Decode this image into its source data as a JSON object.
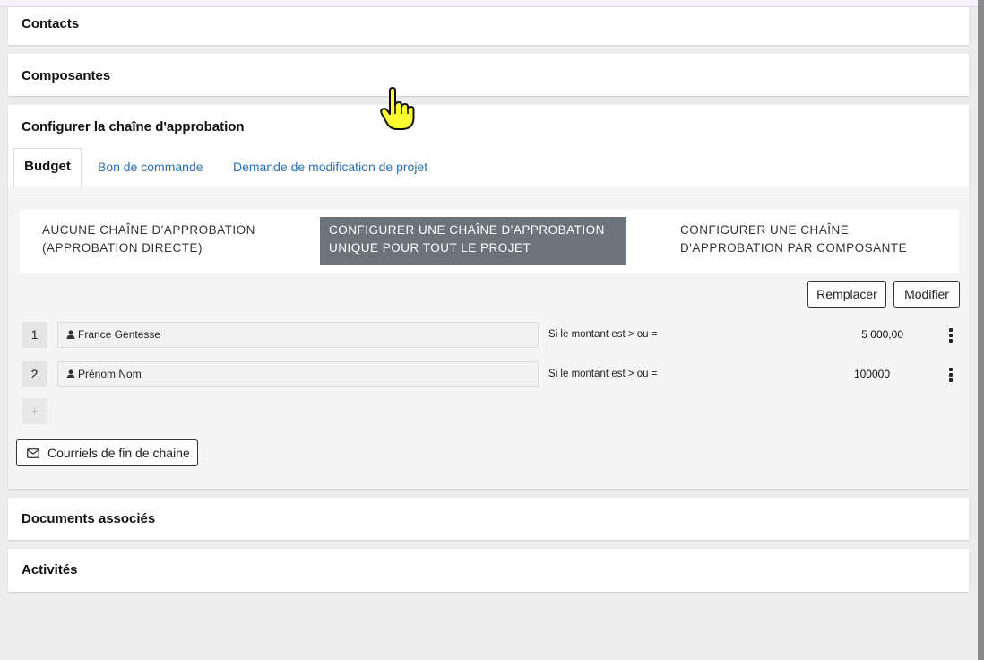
{
  "sections": {
    "contacts": "Contacts",
    "composantes": "Composantes",
    "config": "Configurer la chaîne d'approbation",
    "documents": "Documents associés",
    "activites": "Activités"
  },
  "tabs": [
    "Budget",
    "Bon de commande",
    "Demande de modification de projet"
  ],
  "modes": [
    "AUCUNE CHAÎNE D'APPROBATION (APPROBATION DIRECTE)",
    "CONFIGURER UNE CHAÎNE D'APPROBATION UNIQUE POUR TOUT LE PROJET",
    "CONFIGURER UNE CHAÎNE D'APPROBATION PAR COMPOSANTE"
  ],
  "buttons": {
    "remplacer": "Remplacer",
    "modifier": "Modifier",
    "courriels": "Courriels de fin de chaine",
    "add": "+"
  },
  "chain": [
    {
      "num": "1",
      "name": "France Gentesse",
      "condition": "Si le montant est > ou =",
      "amount": "5 000,00"
    },
    {
      "num": "2",
      "name": "Prénom Nom",
      "condition": "Si le montant est > ou =",
      "amount": "100000"
    }
  ],
  "colors": {
    "tab_link": "#2a6fb5",
    "active_mode_bg": "#6c737a"
  },
  "icons": [
    "user-icon",
    "more-vertical-icon",
    "mail-icon",
    "pointer-hand-icon"
  ]
}
